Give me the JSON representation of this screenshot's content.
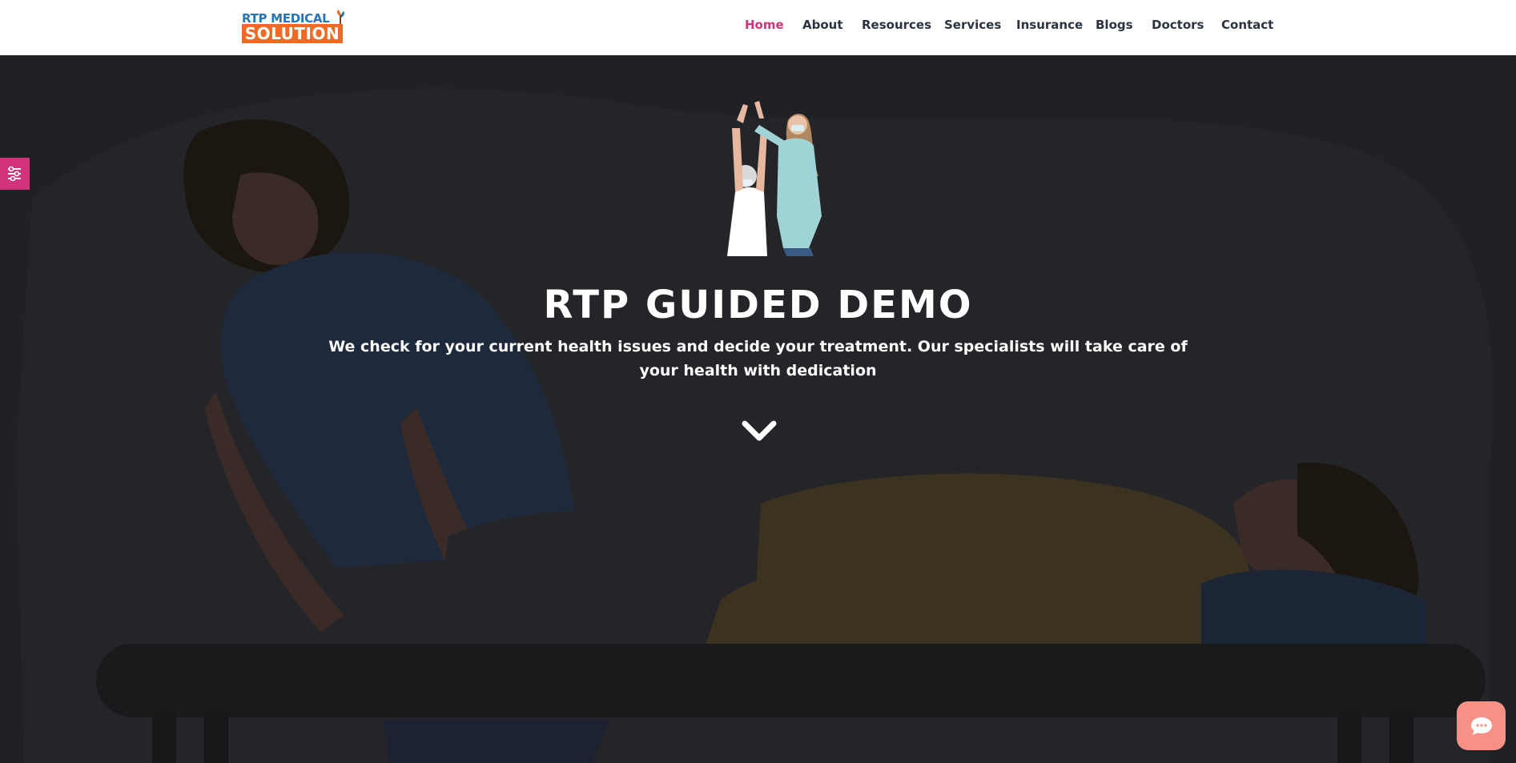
{
  "brand": {
    "logo_top": "RTP MEDICAL",
    "logo_bottom": "SOLUTION"
  },
  "nav": {
    "items": [
      {
        "label": "Home",
        "active": true
      },
      {
        "label": "About"
      },
      {
        "label": "Resources"
      },
      {
        "label": "Services"
      },
      {
        "label": "Insurance"
      },
      {
        "label": "Blogs"
      },
      {
        "label": "Doctors"
      },
      {
        "label": "Contact"
      }
    ]
  },
  "hero": {
    "title": "RTP GUIDED DEMO",
    "subtitle": "We check for your current health issues and decide your treatment. Our specialists will take care of your health with dedication",
    "scroll_icon": "chevron-down-icon",
    "hero_image": "physiotherapy-image"
  },
  "widgets": {
    "side_tab_icon": "sliders-icon",
    "chat_icon": "chat-bubble-icon"
  },
  "colors": {
    "accent": "#d1347b",
    "logo_blue": "#2a74b6",
    "logo_orange": "#f06a24",
    "chat_button": "#f79186",
    "nav_text": "#2b3342",
    "hero_bg": "#202124"
  }
}
